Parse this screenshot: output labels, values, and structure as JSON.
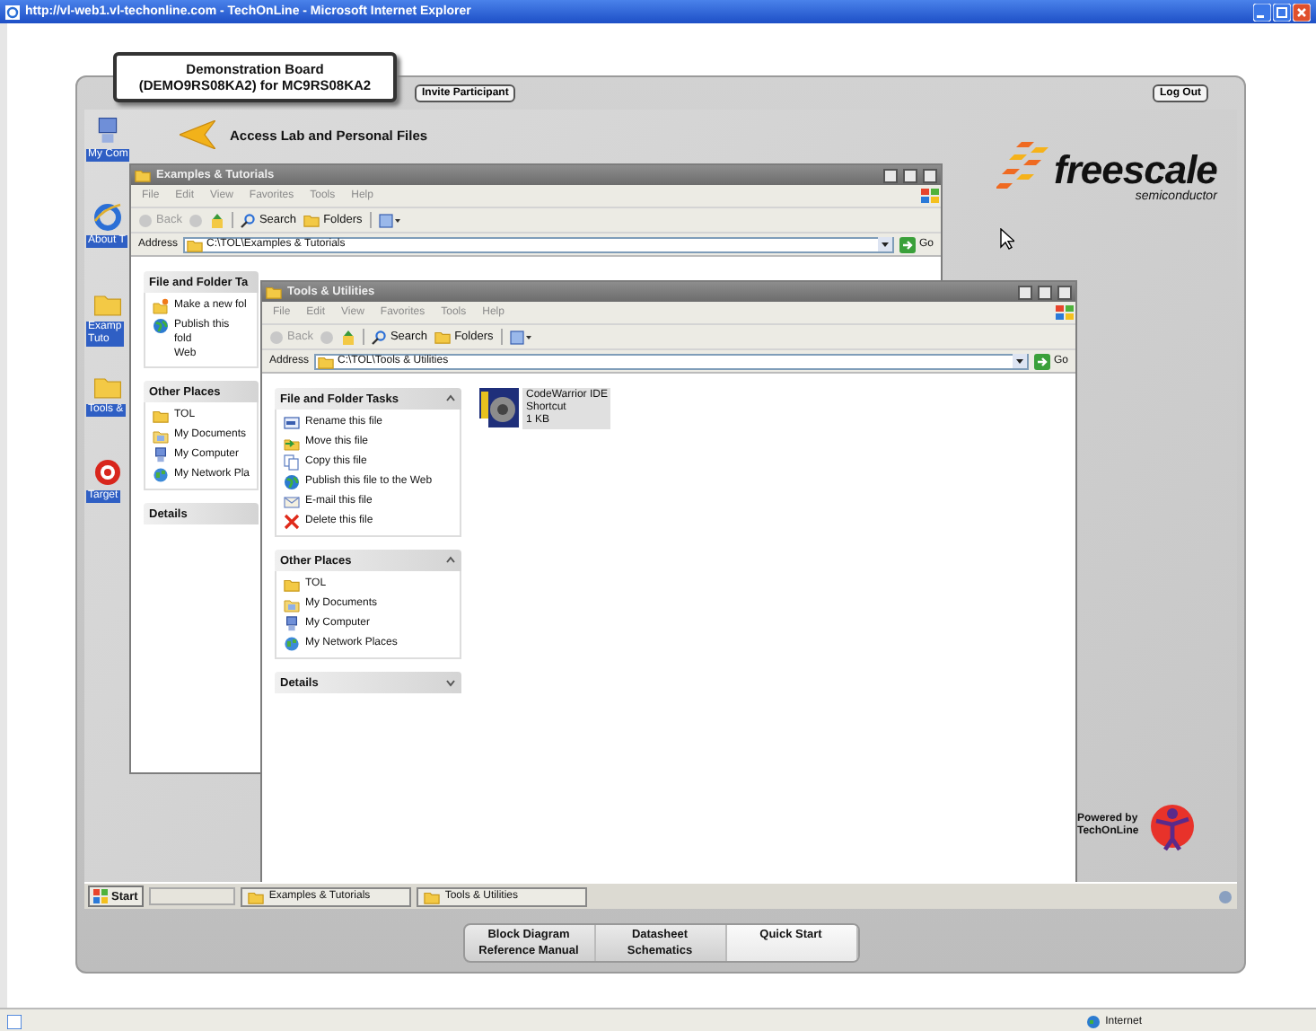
{
  "browser": {
    "title": "http://vl-web1.vl-techonline.com - TechOnLine - Microsoft Internet Explorer",
    "status": "Internet"
  },
  "board": {
    "title": "Demonstration Board\n(DEMO9RS08KA2) for MC9RS08KA2"
  },
  "header_buttons": [
    "Invite Participant",
    "Log Out"
  ],
  "desktop": {
    "access_link": "Access Lab and Personal Files",
    "icons": [
      {
        "label": "My Com",
        "kind": "computer"
      },
      {
        "label": "About T",
        "kind": "browser"
      },
      {
        "label": "Examp\nTuto",
        "kind": "folder"
      },
      {
        "label": "Tools &",
        "kind": "folder"
      },
      {
        "label": "Target",
        "kind": "target"
      }
    ]
  },
  "windows": [
    {
      "title": "Examples & Tutorials",
      "menu": [
        "File",
        "Edit",
        "View",
        "Favorites",
        "Tools",
        "Help"
      ],
      "toolbar": [
        "Back",
        "Search",
        "Folders"
      ],
      "address_label": "Address",
      "address": "C:\\TOL\\Examples & Tutorials",
      "go": "Go",
      "panels": [
        {
          "title": "File and Folder Ta",
          "items": [
            {
              "label": "Make a new fol",
              "kind": "newfolder"
            },
            {
              "label": "Publish this fold\nWeb",
              "kind": "globe"
            }
          ]
        },
        {
          "title": "Other Places",
          "items": [
            {
              "label": "TOL",
              "kind": "folder"
            },
            {
              "label": "My Documents",
              "kind": "documents"
            },
            {
              "label": "My Computer",
              "kind": "computer"
            },
            {
              "label": "My Network Pla",
              "kind": "network"
            }
          ]
        },
        {
          "title": "Details"
        }
      ]
    },
    {
      "title": "Tools & Utilities",
      "menu": [
        "File",
        "Edit",
        "View",
        "Favorites",
        "Tools",
        "Help"
      ],
      "toolbar": [
        "Back",
        "Search",
        "Folders"
      ],
      "address_label": "Address",
      "address": "C:\\TOL\\Tools & Utilities",
      "go": "Go",
      "panels": [
        {
          "title": "File and Folder Tasks",
          "expanded": true,
          "items": [
            {
              "label": "Rename this file",
              "kind": "rename"
            },
            {
              "label": "Move this file",
              "kind": "move"
            },
            {
              "label": "Copy this file",
              "kind": "copy"
            },
            {
              "label": "Publish this file to the Web",
              "kind": "globe"
            },
            {
              "label": "E-mail this file",
              "kind": "email"
            },
            {
              "label": "Delete this file",
              "kind": "delete"
            }
          ]
        },
        {
          "title": "Other Places",
          "expanded": true,
          "items": [
            {
              "label": "TOL",
              "kind": "folder"
            },
            {
              "label": "My Documents",
              "kind": "documents"
            },
            {
              "label": "My Computer",
              "kind": "computer"
            },
            {
              "label": "My Network Places",
              "kind": "network"
            }
          ]
        },
        {
          "title": "Details",
          "expanded": false
        }
      ],
      "files": [
        {
          "name": "CodeWarrior IDE",
          "type": "Shortcut",
          "size": "1 KB",
          "selected": true
        }
      ]
    }
  ],
  "brand": {
    "name": "freescale",
    "tagline": "semiconductor",
    "powered_by": "Powered by\nTechOnLine"
  },
  "taskbar": {
    "start": "Start",
    "buttons": [
      "Examples & Tutorials",
      "Tools & Utilities"
    ]
  },
  "bottom_nav": {
    "columns": [
      {
        "items": [
          "Block Diagram",
          "Reference Manual"
        ],
        "selected": false
      },
      {
        "items": [
          "Datasheet",
          "Schematics"
        ],
        "selected": false
      },
      {
        "items": [
          "Quick Start"
        ],
        "selected": true
      }
    ]
  }
}
